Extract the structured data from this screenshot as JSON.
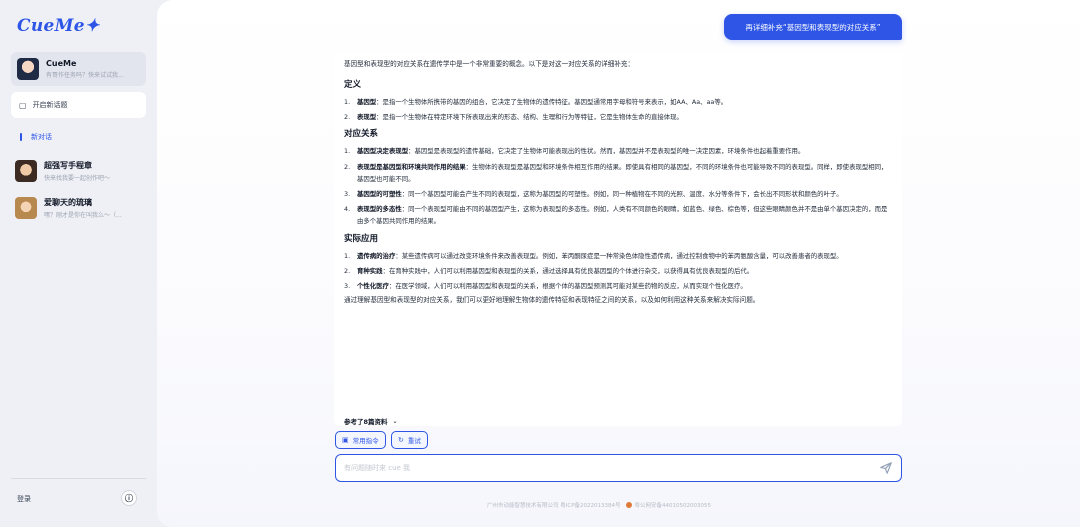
{
  "app": {
    "logo": "CueMe✦"
  },
  "sidebar": {
    "current_chat": {
      "name": "CueMe",
      "preview": "有哥作任务吗？快来试试我..."
    },
    "new_topic_label": "开启新话题",
    "section_label": "新对话",
    "chats": [
      {
        "name": "超强写手程章",
        "preview": "快来找我要一起创作吧～"
      },
      {
        "name": "爱聊天的琉璃",
        "preview": "嘿？刚才是你在叫我么～（..."
      }
    ],
    "login_label": "登录",
    "info_icon": "ⓘ"
  },
  "conversation": {
    "user_message": "再详细补充“基因型和表现型的对应关系”",
    "intro": "基因型和表现型的对应关系在遗传学中是一个非常重要的概念。以下是对这一对应关系的详细补充：",
    "sections": [
      {
        "title": "定义",
        "items": [
          {
            "n": "1.",
            "term": "基因型",
            "text": "：是指一个生物体所携带的基因的组合，它决定了生物体的遗传特征。基因型通常用字母和符号来表示，如AA、Aa、aa等。"
          },
          {
            "n": "2.",
            "term": "表现型",
            "text": "：是指一个生物体在特定环境下所表现出来的形态、结构、生理和行为等特征，它是生物体生命的直接体现。"
          }
        ]
      },
      {
        "title": "对应关系",
        "items": [
          {
            "n": "1.",
            "term": "基因型决定表现型",
            "text": "：基因型是表现型的遗传基础，它决定了生物体可能表现出的性状。然而，基因型并不是表现型的唯一决定因素，环境条件也起着重要作用。"
          },
          {
            "n": "2.",
            "term": "表现型是基因型和环境共同作用的结果",
            "text": "：生物体的表现型是基因型和环境条件相互作用的结果。即使具有相同的基因型，不同的环境条件也可能导致不同的表现型。同样，即使表现型相同，基因型也可能不同。"
          },
          {
            "n": "3.",
            "term": "基因型的可塑性",
            "text": "：同一个基因型可能会产生不同的表现型，这称为基因型的可塑性。例如，同一种植物在不同的光照、温度、水分等条件下，会长出不同形状和颜色的叶子。"
          },
          {
            "n": "4.",
            "term": "表现型的多态性",
            "text": "：同一个表现型可能由不同的基因型产生，这称为表现型的多态性。例如，人类有不同颜色的眼睛，如蓝色、绿色、棕色等，但这些眼睛颜色并不是由单个基因决定的，而是由多个基因共同作用的结果。"
          }
        ]
      },
      {
        "title": "实际应用",
        "items": [
          {
            "n": "1.",
            "term": "遗传病的治疗",
            "text": "：某些遗传病可以通过改变环境条件来改善表现型。例如，苯丙酮尿症是一种常染色体隐性遗传病，通过控制食物中的苯丙氨酸含量，可以改善患者的表现型。"
          },
          {
            "n": "2.",
            "term": "育种实践",
            "text": "：在育种实践中，人们可以利用基因型和表现型的关系，通过选择具有优良基因型的个体进行杂交，以获得具有优良表现型的后代。"
          },
          {
            "n": "3.",
            "term": "个性化医疗",
            "text": "：在医学领域，人们可以利用基因型和表现型的关系，根据个体的基因型预测其可能对某些药物的反应，从而实现个性化医疗。"
          }
        ]
      }
    ],
    "outro": "通过理解基因型和表现型的对应关系，我们可以更好地理解生物体的遗传特征和表现特征之间的关系，以及如何利用这种关系来解决实际问题。",
    "refs_label": "参考了8篇资料",
    "common_cmd_label": "常用指令",
    "retry_label": "重试"
  },
  "input": {
    "placeholder": "有问题随时来 cue 我"
  },
  "footer": {
    "company": "广州市动能智慧技术有限公司 粤ICP备2022013384号",
    "police": "粤公网安备44010502003055"
  },
  "colors": {
    "accent": "#2e55e6",
    "sidebar_bg": "#eef0f6"
  }
}
